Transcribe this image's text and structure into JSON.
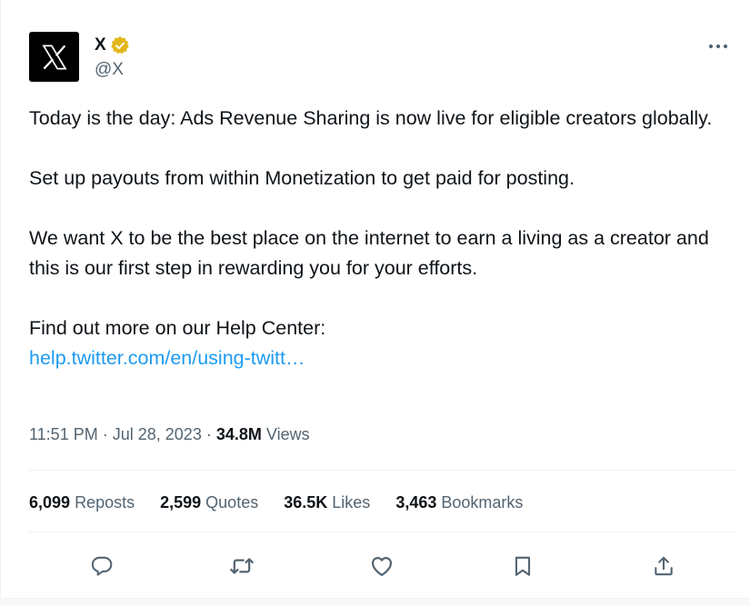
{
  "author": {
    "display_name": "X",
    "handle": "@X",
    "verified_color": "#e2b719"
  },
  "post": {
    "paragraphs": [
      "Today is the day: Ads Revenue Sharing is now live for eligible creators globally.",
      "Set up payouts from within Monetization to get paid for posting.",
      "We want X to be the best place on the internet to earn a living as a creator and this is our first step in rewarding you for your efforts.",
      "Find out more on our Help Center:"
    ],
    "link_text": "help.twitter.com/en/using-twitt…"
  },
  "meta": {
    "time": "11:51 PM",
    "separator": "·",
    "date": "Jul 28, 2023",
    "views_count": "34.8M",
    "views_label": "Views"
  },
  "stats": {
    "reposts_count": "6,099",
    "reposts_label": "Reposts",
    "quotes_count": "2,599",
    "quotes_label": "Quotes",
    "likes_count": "36.5K",
    "likes_label": "Likes",
    "bookmarks_count": "3,463",
    "bookmarks_label": "Bookmarks"
  },
  "colors": {
    "link": "#1d9bf0",
    "secondary_text": "#536471",
    "primary_text": "#0f1419"
  }
}
